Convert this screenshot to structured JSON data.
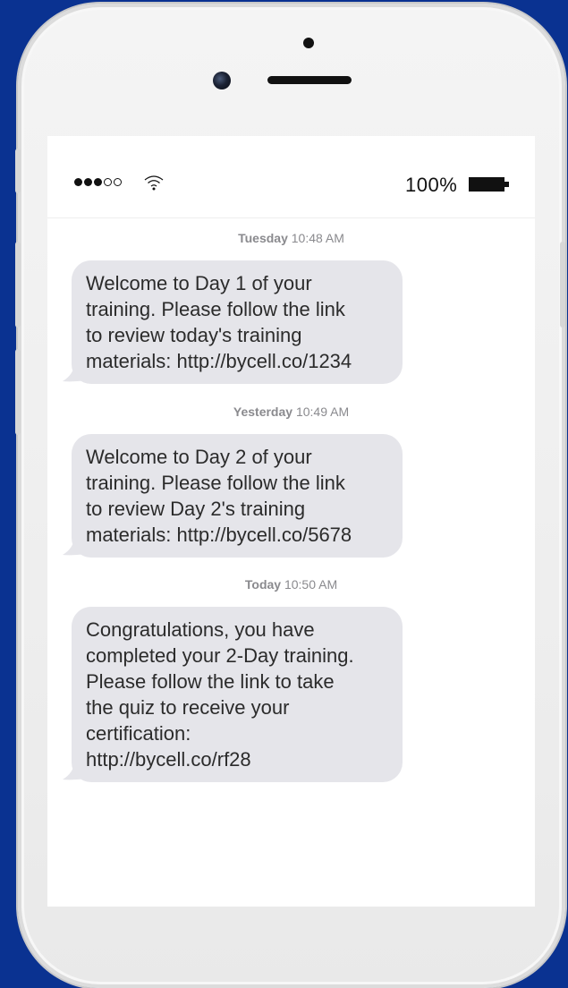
{
  "status_bar": {
    "signal_filled": 3,
    "signal_total": 5,
    "battery_percent": "100%",
    "icons": [
      "signal-icon",
      "wifi-icon",
      "battery-icon"
    ]
  },
  "messages": [
    {
      "day": "Tuesday",
      "time": "10:48 AM",
      "text": "Welcome to Day 1 of your\ntraining. Please follow the link\nto review today's training\nmaterials: http://bycell.co/1234"
    },
    {
      "day": "Yesterday",
      "time": "10:49 AM",
      "text": "Welcome to Day 2 of your\ntraining. Please follow the link\nto review Day 2's training\nmaterials: http://bycell.co/5678"
    },
    {
      "day": "Today",
      "time": "10:50 AM",
      "text": "Congratulations, you have\ncompleted your 2-Day training.\nPlease follow the link to take\nthe quiz to receive your\ncertification:\nhttp://bycell.co/rf28"
    }
  ],
  "colors": {
    "background": "#0a3291",
    "bubble": "#e5e5ea",
    "timestamp": "#8a8a8e"
  }
}
